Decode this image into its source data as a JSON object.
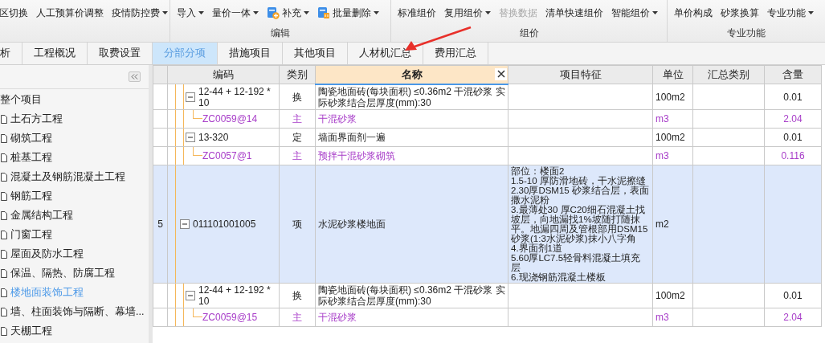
{
  "toolbar": {
    "groups": [
      {
        "items": [
          {
            "label": "区切换",
            "kind": "plain",
            "dropdown": false,
            "disabled": false
          },
          {
            "label": "人工预算价调整",
            "kind": "plain",
            "dropdown": false,
            "disabled": false
          },
          {
            "label": "疫情防控费",
            "kind": "plain",
            "dropdown": true,
            "disabled": false
          }
        ]
      },
      {
        "label": "编辑",
        "items": [
          {
            "label": "导入",
            "kind": "plain",
            "dropdown": true,
            "disabled": false
          },
          {
            "label": "量价一体",
            "kind": "plain",
            "dropdown": true,
            "disabled": false
          },
          {
            "label": "补充",
            "kind": "add",
            "dropdown": true,
            "disabled": false
          },
          {
            "label": "批量删除",
            "kind": "remove",
            "dropdown": true,
            "disabled": false
          }
        ]
      },
      {
        "label": "组价",
        "items": [
          {
            "label": "标准组价",
            "kind": "plain",
            "dropdown": false,
            "disabled": false
          },
          {
            "label": "复用组价",
            "kind": "plain",
            "dropdown": true,
            "disabled": false
          },
          {
            "label": "替换数据",
            "kind": "plain",
            "dropdown": false,
            "disabled": true
          },
          {
            "label": "清单快速组价",
            "kind": "plain",
            "dropdown": false,
            "disabled": false
          },
          {
            "label": "智能组价",
            "kind": "plain",
            "dropdown": true,
            "disabled": false
          }
        ]
      },
      {
        "label": "专业功能",
        "items": [
          {
            "label": "单价构成",
            "kind": "plain",
            "dropdown": false,
            "disabled": false
          },
          {
            "label": "砂浆换算",
            "kind": "plain",
            "dropdown": false,
            "disabled": false
          },
          {
            "label": "专业功能",
            "kind": "plain",
            "dropdown": true,
            "disabled": false
          }
        ]
      }
    ]
  },
  "tabs": [
    {
      "label": "析",
      "selected": false
    },
    {
      "label": "工程概况",
      "selected": false
    },
    {
      "label": "取费设置",
      "selected": false
    },
    {
      "label": "分部分项",
      "selected": true
    },
    {
      "label": "措施项目",
      "selected": false
    },
    {
      "label": "其他项目",
      "selected": false
    },
    {
      "label": "人材机汇总",
      "selected": false
    },
    {
      "label": "费用汇总",
      "selected": false
    }
  ],
  "sidebar": {
    "tree": {
      "label": "整个项目",
      "selected": false,
      "children": [
        {
          "label": "土石方工程",
          "selected": false
        },
        {
          "label": "砌筑工程",
          "selected": false
        },
        {
          "label": "桩基工程",
          "selected": false
        },
        {
          "label": "混凝土及钢筋混凝土工程",
          "selected": false
        },
        {
          "label": "钢筋工程",
          "selected": false
        },
        {
          "label": "金属结构工程",
          "selected": false
        },
        {
          "label": "门窗工程",
          "selected": false
        },
        {
          "label": "屋面及防水工程",
          "selected": false
        },
        {
          "label": "保温、隔热、防腐工程",
          "selected": false
        },
        {
          "label": "楼地面装饰工程",
          "selected": true
        },
        {
          "label": "墙、柱面装饰与隔断、幕墙...",
          "selected": false
        },
        {
          "label": "天棚工程",
          "selected": false
        }
      ]
    }
  },
  "table": {
    "columns": [
      {
        "label": "编码",
        "active": false
      },
      {
        "label": "类别",
        "active": false
      },
      {
        "label": "名称",
        "active": true
      },
      {
        "label": "项目特征",
        "active": false
      },
      {
        "label": "单位",
        "active": false
      },
      {
        "label": "汇总类别",
        "active": false
      },
      {
        "label": "含量",
        "active": false
      }
    ],
    "rows": [
      {
        "kind": "quota",
        "selected": false,
        "expanded": true,
        "code": "12-44 + 12-192 * 10",
        "category": "换",
        "name": "陶瓷地面砖(每块面积) ≤0.36m2 干混砂浆 实际砂浆结合层厚度(mm):30",
        "unit": "100m2",
        "quantity": "0.01",
        "children": [
          {
            "kind": "material",
            "selected": false,
            "code": "ZC0059@14",
            "category": "主",
            "name": "干混砂浆",
            "unit": "m3",
            "quantity": "2.04"
          }
        ]
      },
      {
        "kind": "quota",
        "selected": false,
        "expanded": true,
        "code": "13-320",
        "category": "定",
        "name": "墙面界面剂一遍",
        "unit": "100m2",
        "quantity": "0.01",
        "children": [
          {
            "kind": "material",
            "selected": false,
            "code": "ZC0057@1",
            "category": "主",
            "name": "预拌干混砂浆砌筑",
            "unit": "m3",
            "quantity": "0.116"
          }
        ]
      },
      {
        "kind": "item",
        "selected": true,
        "expanded": true,
        "number": "5",
        "code": "011101001005",
        "category": "项",
        "name": "水泥砂浆楼地面",
        "features": "部位：楼面2\n1.5-10 厚防滑地砖，干水泥擦缝\n2.30厚DSM15 砂浆结合层，表面撒水泥粉\n3.最薄处30 厚C20细石混凝土找坡层，向地漏找1%坡随打随抹平。地漏四周及管根部用DSM15砂浆(1:3水泥砂浆)抹小八字角\n4.界面剂1道\n5.60厚LC7.5轻骨料混凝土填充层\n6.现浇钢筋混凝土楼板",
        "unit": "m2",
        "children": [
          {
            "kind": "quota",
            "selected": false,
            "expanded": true,
            "code": "12-44 + 12-192 * 10",
            "category": "换",
            "name": "陶瓷地面砖(每块面积) ≤0.36m2 干混砂浆 实际砂浆结合层厚度(mm):30",
            "unit": "100m2",
            "quantity": "0.01",
            "children": [
              {
                "kind": "material",
                "selected": false,
                "code": "ZC0059@15",
                "category": "主",
                "name": "干混砂浆",
                "unit": "m3",
                "quantity": "2.04"
              }
            ]
          }
        ]
      }
    ]
  }
}
